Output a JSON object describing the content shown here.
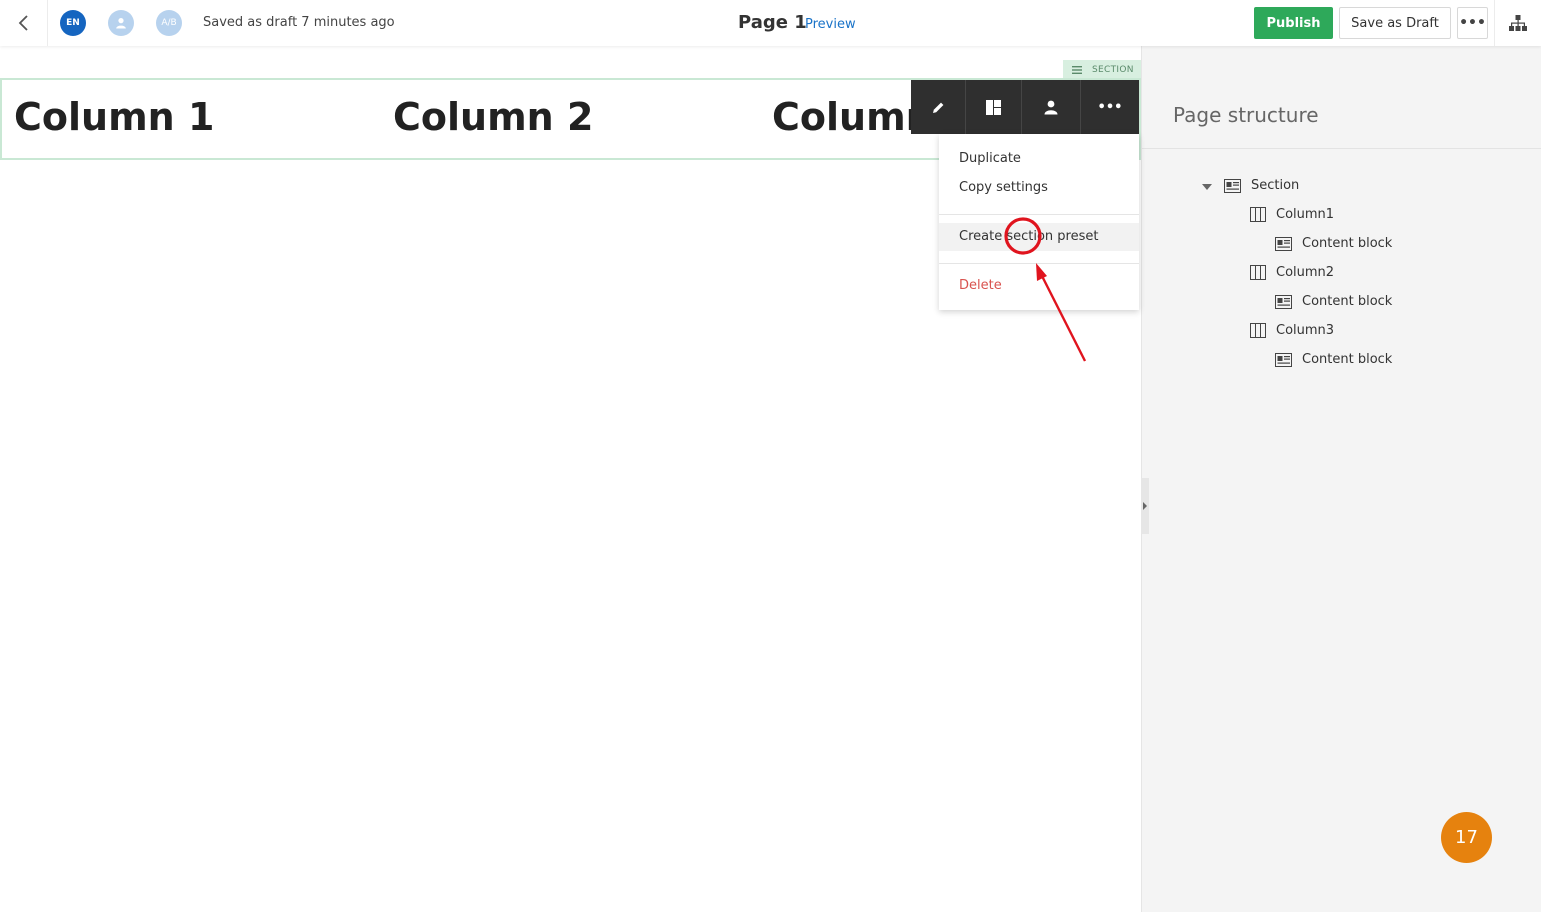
{
  "header": {
    "language": "EN",
    "ab_label": "A/B",
    "saved_status": "Saved as draft 7 minutes ago",
    "page_title": "Page 1",
    "preview_label": "Preview",
    "publish_label": "Publish",
    "save_draft_label": "Save as Draft",
    "more_label": "•••"
  },
  "canvas": {
    "section_tag": "SECTION",
    "columns": [
      "Column 1",
      "Column 2",
      "Column"
    ]
  },
  "toolbar": {
    "items": [
      "pencil-icon",
      "layout-icon",
      "person-icon",
      "more-icon"
    ],
    "more_label": "•••"
  },
  "context_menu": {
    "items": [
      "Duplicate",
      "Copy settings",
      "Create section preset",
      "Delete"
    ],
    "highlighted": "Create section preset",
    "delete_color": "#d9534f"
  },
  "panel": {
    "title": "Page structure",
    "tree": [
      {
        "label": "Section",
        "icon": "section-icon"
      },
      {
        "label": "Column1",
        "icon": "column-icon"
      },
      {
        "label": "Content block",
        "icon": "content-block-icon"
      },
      {
        "label": "Column2",
        "icon": "column-icon"
      },
      {
        "label": "Content block",
        "icon": "content-block-icon"
      },
      {
        "label": "Column3",
        "icon": "column-icon"
      },
      {
        "label": "Content block",
        "icon": "content-block-icon"
      }
    ],
    "badge_count": "17"
  },
  "colors": {
    "publish": "#2ea95a",
    "toolbar": "#2f2f2f",
    "badge": "#e6820e",
    "link": "#1a73c8",
    "annotation": "#e0141e"
  }
}
